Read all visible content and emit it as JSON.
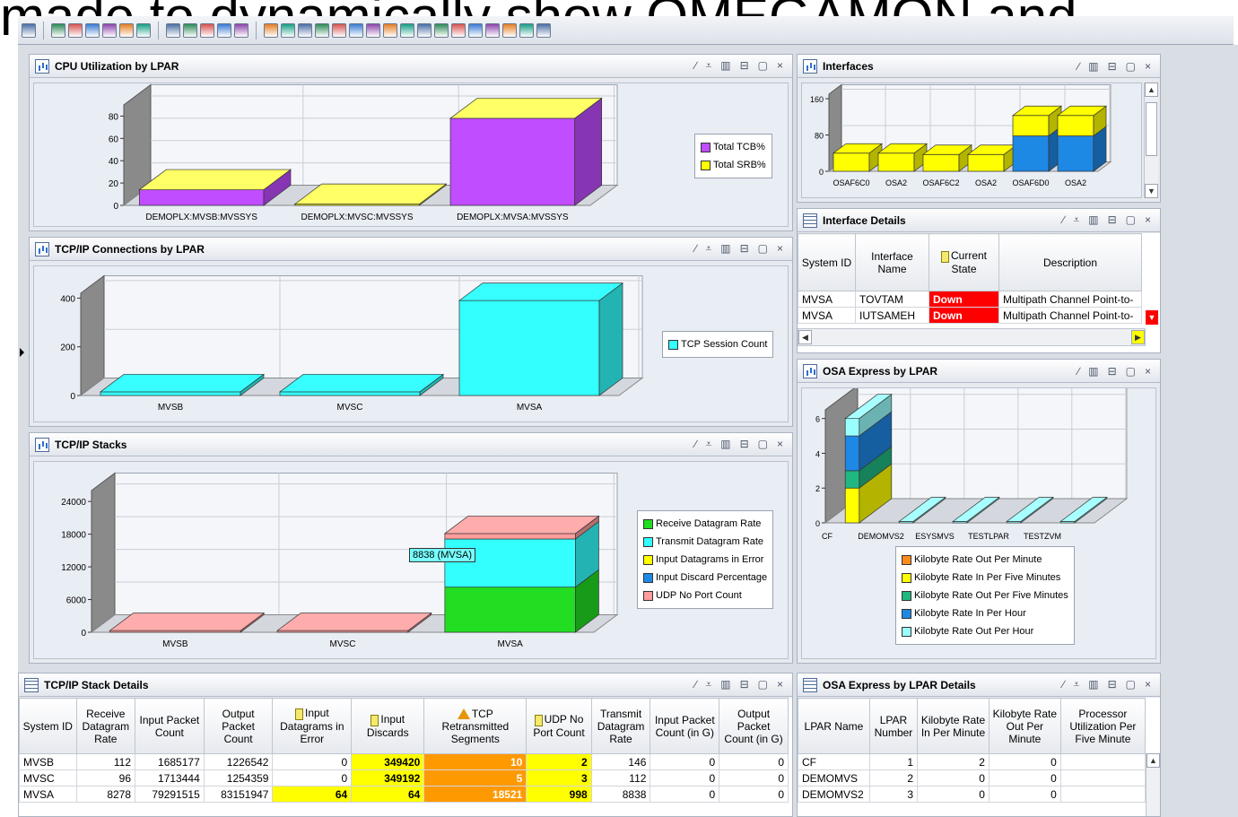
{
  "overlay_text": "made to dynamically show OMEGAMON and",
  "toolbar": {
    "icons": [
      "save-icon",
      "grid-icon",
      "report-icon",
      "link-icon",
      "network-icon",
      "user-icon",
      "help-icon",
      "stop-gray-icon",
      "stop-red-icon",
      "refresh-icon",
      "home-icon",
      "back-icon",
      "palette-icon",
      "table-icon",
      "pie-icon",
      "bar-chart-icon",
      "line-chart-icon",
      "gauge-icon",
      "save-disk-icon",
      "text-icon",
      "notes-icon",
      "notepad-icon",
      "message-icon",
      "globe-icon",
      "filter-icon",
      "flag-icon",
      "camera-icon",
      "topology-icon",
      "grid2-icon"
    ]
  },
  "panels": {
    "cpu": {
      "title": "CPU Utilization by LPAR",
      "chart_data": {
        "type": "bar",
        "stacked": true,
        "categories": [
          "DEMOPLX:MVSB:MVSSYS",
          "DEMOPLX:MVSC:MVSSYS",
          "DEMOPLX:MVSA:MVSSYS"
        ],
        "series": [
          {
            "name": "Total TCB%",
            "color": "#c04dff",
            "values": [
              14,
              0,
              78
            ]
          },
          {
            "name": "Total SRB%",
            "color": "#ffff00",
            "values": [
              0,
              0,
              0
            ]
          }
        ],
        "yticks": [
          0,
          20,
          40,
          60,
          80
        ],
        "ylim": [
          0,
          90
        ]
      }
    },
    "interfaces": {
      "title": "Interfaces",
      "chart_data": {
        "type": "bar",
        "stacked": true,
        "categories": [
          "OSAF6C0",
          "OSA2",
          "OSAF6C2",
          "OSA2",
          "OSAF6D0",
          "OSA2"
        ],
        "series": [
          {
            "name": "",
            "color": "#1e88e5",
            "values": [
              0,
              0,
              0,
              0,
              78,
              78
            ]
          },
          {
            "name": "",
            "color": "#ffff00",
            "values": [
              40,
              40,
              37,
              37,
              45,
              45
            ]
          }
        ],
        "yticks": [
          0,
          80,
          160
        ],
        "ylim": [
          0,
          170
        ]
      }
    },
    "tcpconn": {
      "title": "TCP/IP Connections by LPAR",
      "chart_data": {
        "type": "bar",
        "stacked": true,
        "categories": [
          "MVSB",
          "MVSC",
          "MVSA"
        ],
        "series": [
          {
            "name": "TCP Session Count",
            "color": "#33ffff",
            "values": [
              15,
              15,
              390
            ]
          }
        ],
        "yticks": [
          0,
          200,
          400
        ],
        "ylim": [
          0,
          420
        ]
      }
    },
    "stacks": {
      "title": "TCP/IP Stacks",
      "tooltip": "8838 (MVSA)",
      "chart_data": {
        "type": "bar",
        "stacked": true,
        "categories": [
          "MVSB",
          "MVSC",
          "MVSA"
        ],
        "series": [
          {
            "name": "Receive Datagram Rate",
            "color": "#22dd22",
            "values": [
              0,
              0,
              8278
            ]
          },
          {
            "name": "Transmit Datagram Rate",
            "color": "#33ffff",
            "values": [
              0,
              0,
              8838
            ]
          },
          {
            "name": "Input Datagrams in Error",
            "color": "#ffff00",
            "values": [
              0,
              0,
              0
            ]
          },
          {
            "name": "Input Discard Percentage",
            "color": "#1e88e5",
            "values": [
              0,
              0,
              0
            ]
          },
          {
            "name": "UDP No Port Count",
            "color": "#ff9c9c",
            "values": [
              0,
              0,
              998
            ]
          }
        ],
        "yticks": [
          0,
          6000,
          12000,
          18000,
          24000
        ],
        "ylim": [
          0,
          26000
        ]
      }
    },
    "ifdetails": {
      "title": "Interface Details",
      "columns": [
        "System ID",
        "Interface Name",
        "Current State",
        "Description"
      ],
      "rows": [
        {
          "system": "MVSA",
          "name": "TOVTAM",
          "state": "Down",
          "desc": "Multipath Channel Point-to-"
        },
        {
          "system": "MVSA",
          "name": "IUTSAMEH",
          "state": "Down",
          "desc": "Multipath Channel Point-to-"
        }
      ]
    },
    "osa": {
      "title": "OSA Express by LPAR",
      "chart_data": {
        "type": "bar",
        "stacked": true,
        "categories": [
          "CF",
          "DEMOMVS2",
          "ESYSMVS",
          "TESTLPAR",
          "TESTZVM"
        ],
        "series": [
          {
            "name": "Kilobyte Rate Out Per Minute",
            "color": "#ff8c1a",
            "values": [
              0,
              0,
              0,
              0,
              0
            ]
          },
          {
            "name": "Kilobyte Rate In Per Five Minutes",
            "color": "#ffff00",
            "values": [
              2,
              0,
              0,
              0,
              0
            ]
          },
          {
            "name": "Kilobyte Rate Out Per Five Minutes",
            "color": "#20b880",
            "values": [
              1,
              0,
              0,
              0,
              0
            ]
          },
          {
            "name": "Kilobyte Rate In Per Hour",
            "color": "#1e88e5",
            "values": [
              2,
              0,
              0,
              0,
              0
            ]
          },
          {
            "name": "Kilobyte Rate Out Per Hour",
            "color": "#99ffff",
            "values": [
              1,
              0,
              0,
              0,
              0
            ]
          }
        ],
        "yticks": [
          0,
          2,
          4,
          6
        ],
        "ylim": [
          0,
          6.5
        ]
      }
    },
    "stackdetails": {
      "title": "TCP/IP Stack Details",
      "columns": [
        "System ID",
        "Receive Datagram Rate",
        "Input Packet Count",
        "Output Packet Count",
        "Input Datagrams in Error",
        "Input Discards",
        "TCP Retransmitted Segments",
        "UDP No Port Count",
        "Transmit Datagram Rate",
        "Input Packet Count (in G)",
        "Output Packet Count (in G)"
      ],
      "rows": [
        [
          "MVSB",
          "112",
          "1685177",
          "1226542",
          "0",
          "349420",
          "10",
          "2",
          "146",
          "0",
          "0"
        ],
        [
          "MVSC",
          "96",
          "1713444",
          "1254359",
          "0",
          "349192",
          "5",
          "3",
          "112",
          "0",
          "0"
        ],
        [
          "MVSA",
          "8278",
          "79291515",
          "83151947",
          "64",
          "64",
          "18521",
          "998",
          "8838",
          "0",
          "0"
        ]
      ]
    },
    "osadetails": {
      "title": "OSA Express by LPAR Details",
      "columns": [
        "LPAR Name",
        "LPAR Number",
        "Kilobyte Rate In Per Minute",
        "Kilobyte Rate Out Per Minute",
        "Processor Utilization Per Five Minute"
      ],
      "rows": [
        [
          "CF",
          "1",
          "2",
          "0",
          ""
        ],
        [
          "DEMOMVS",
          "2",
          "0",
          "0",
          ""
        ],
        [
          "DEMOMVS2",
          "3",
          "0",
          "0",
          ""
        ]
      ]
    }
  }
}
